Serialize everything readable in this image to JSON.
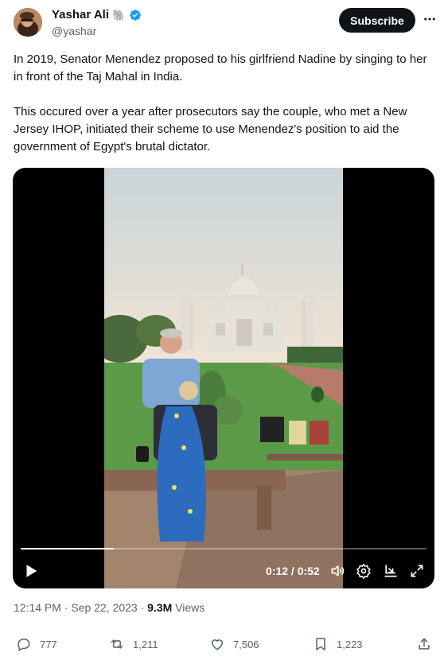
{
  "author": {
    "name": "Yashar Ali",
    "emoji": "🐘",
    "handle": "@yashar"
  },
  "header": {
    "subscribe_label": "Subscribe"
  },
  "tweet": {
    "paragraphs": [
      "In 2019, Senator Menendez proposed to his girlfriend Nadine by singing to her in front of the Taj Mahal in India.",
      "This occured over a year after prosecutors say the couple, who met a New Jersey IHOP, initiated their scheme to use Menendez's position to aid the government of Egypt's brutal dictator."
    ]
  },
  "video": {
    "time_display": "0:12 / 0:52",
    "progress": 0.23
  },
  "meta": {
    "time": "12:14 PM",
    "date": "Sep 22, 2023",
    "separator": "·",
    "views_count": "9.3M",
    "views_label": "Views"
  },
  "actions": {
    "replies": "777",
    "reposts": "1,211",
    "likes": "7,506",
    "bookmarks": "1,223"
  },
  "colors": {
    "verified": "#1d9bf0",
    "text": "#0f1419",
    "muted": "#536471"
  }
}
